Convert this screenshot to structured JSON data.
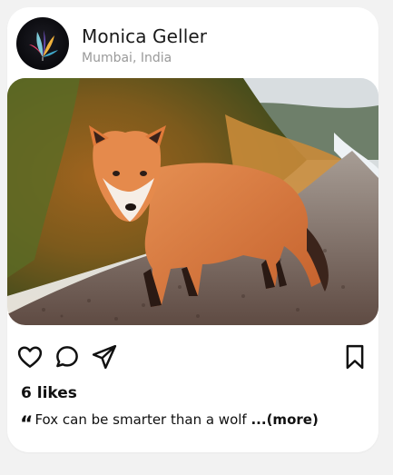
{
  "post": {
    "user": {
      "name": "Monica Geller",
      "location": "Mumbai, India"
    },
    "image": {
      "subject": "fox-on-gravel-path"
    },
    "actions": {
      "like": "heart-icon",
      "comment": "comment-icon",
      "share": "send-icon",
      "save": "bookmark-icon"
    },
    "likes": "6 likes",
    "caption": {
      "quote_mark": "“",
      "text": "Fox can be smarter than a wolf",
      "more": "...(more)"
    }
  }
}
